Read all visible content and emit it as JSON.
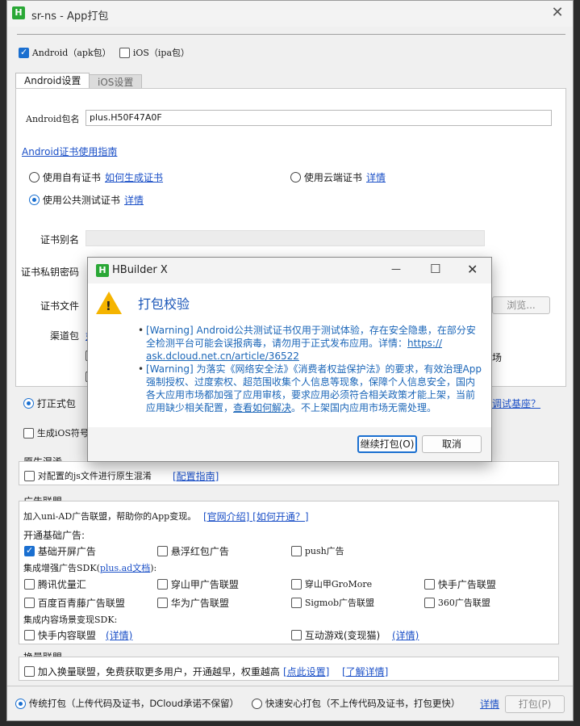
{
  "window": {
    "title": "sr-ns - App打包",
    "close": "✕",
    "app_icon": "H"
  },
  "platforms": {
    "android": "Android（apk包）",
    "ios": "iOS（ipa包）"
  },
  "tabs": {
    "android": "Android设置",
    "ios": "iOS设置"
  },
  "android": {
    "package_label": "Android包名",
    "package_value": "plus.H50F47A0F",
    "cert_guide": "Android证书使用指南",
    "own_cert": "使用自有证书",
    "how_generate": "如何生成证书",
    "cloud_cert": "使用云端证书",
    "cloud_detail": "详情",
    "public_cert": "使用公共测试证书",
    "public_detail": "详情",
    "alias_label": "证书别名",
    "key_label": "证书私钥密码",
    "file_label": "证书文件",
    "browse": "浏览...",
    "channel_label": "渠道包",
    "channel_link": "如",
    "market_tail": "场"
  },
  "build_type": {
    "release": "打正式包",
    "debug_link": "调试基座？",
    "ios_symbol": "生成iOS符号"
  },
  "obfuscation": {
    "title": "原生混淆",
    "label": "对配置的js文件进行原生混淆",
    "guide": "[配置指南]"
  },
  "ads": {
    "title": "广告联盟",
    "intro": "加入uni-AD广告联盟，帮助你的App变现。",
    "intro_links": "[官网介绍] [如何开通？]",
    "basic_title": "开通基础广告:",
    "basic": [
      "基础开屏广告",
      "悬浮红包广告",
      "push广告"
    ],
    "enhanced_title_pre": "集成增强广告SDK(",
    "enhanced_title_link": "plus.ad文档",
    "enhanced_title_post": "):",
    "enhanced_row1": [
      "腾讯优量汇",
      "穿山甲广告联盟",
      "穿山甲GroMore",
      "快手广告联盟"
    ],
    "enhanced_row2": [
      "百度百青藤广告联盟",
      "华为广告联盟",
      "Sigmob广告联盟",
      "360广告联盟"
    ],
    "content_title": "集成内容场景变现SDK:",
    "content1": "快手内容联盟",
    "content1_link": "(详情)",
    "content2": "互动游戏(变现猫)",
    "content2_link": "(详情)"
  },
  "exchange": {
    "title": "换量联盟",
    "label": "加入换量联盟，免费获取更多用户，开通越早，权重越高",
    "link1": "[点此设置]",
    "link2": "[了解详情]"
  },
  "footer": {
    "traditional": "传统打包（上传代码及证书，DCloud承诺不保留）",
    "safe": "快速安心打包（不上传代码及证书，打包更快）",
    "detail": "详情",
    "pack": "打包(P)"
  },
  "dialog": {
    "title": "HBuilder X",
    "icon_letter": "H",
    "minimize": "—",
    "maximize": "☐",
    "close": "✕",
    "heading": "打包校验",
    "warn1": "[Warning] Android公共测试证书仅用于测试体验，存在安全隐患，在部分安全检测平台可能会误报病毒，请勿用于正式发布应用。详情：",
    "warn1_link_a": "https://",
    "warn1_link_b": "ask.dcloud.net.cn/article/36522",
    "warn2_a": "[Warning] 为落实《网络安全法》《消费者权益保护法》的要求，有效治理App强制授权、过度索权、超范围收集个人信息等现象，保障个人信息安全，国内各大应用市场都加强了应用审核，要求应用必须符合相关政策才能上架，当前应用缺少相关配置，",
    "warn2_link": "查看如何解决",
    "warn2_b": "。不上架国内应用市场无需处理。",
    "continue": "继续打包(O)",
    "cancel": "取消"
  }
}
